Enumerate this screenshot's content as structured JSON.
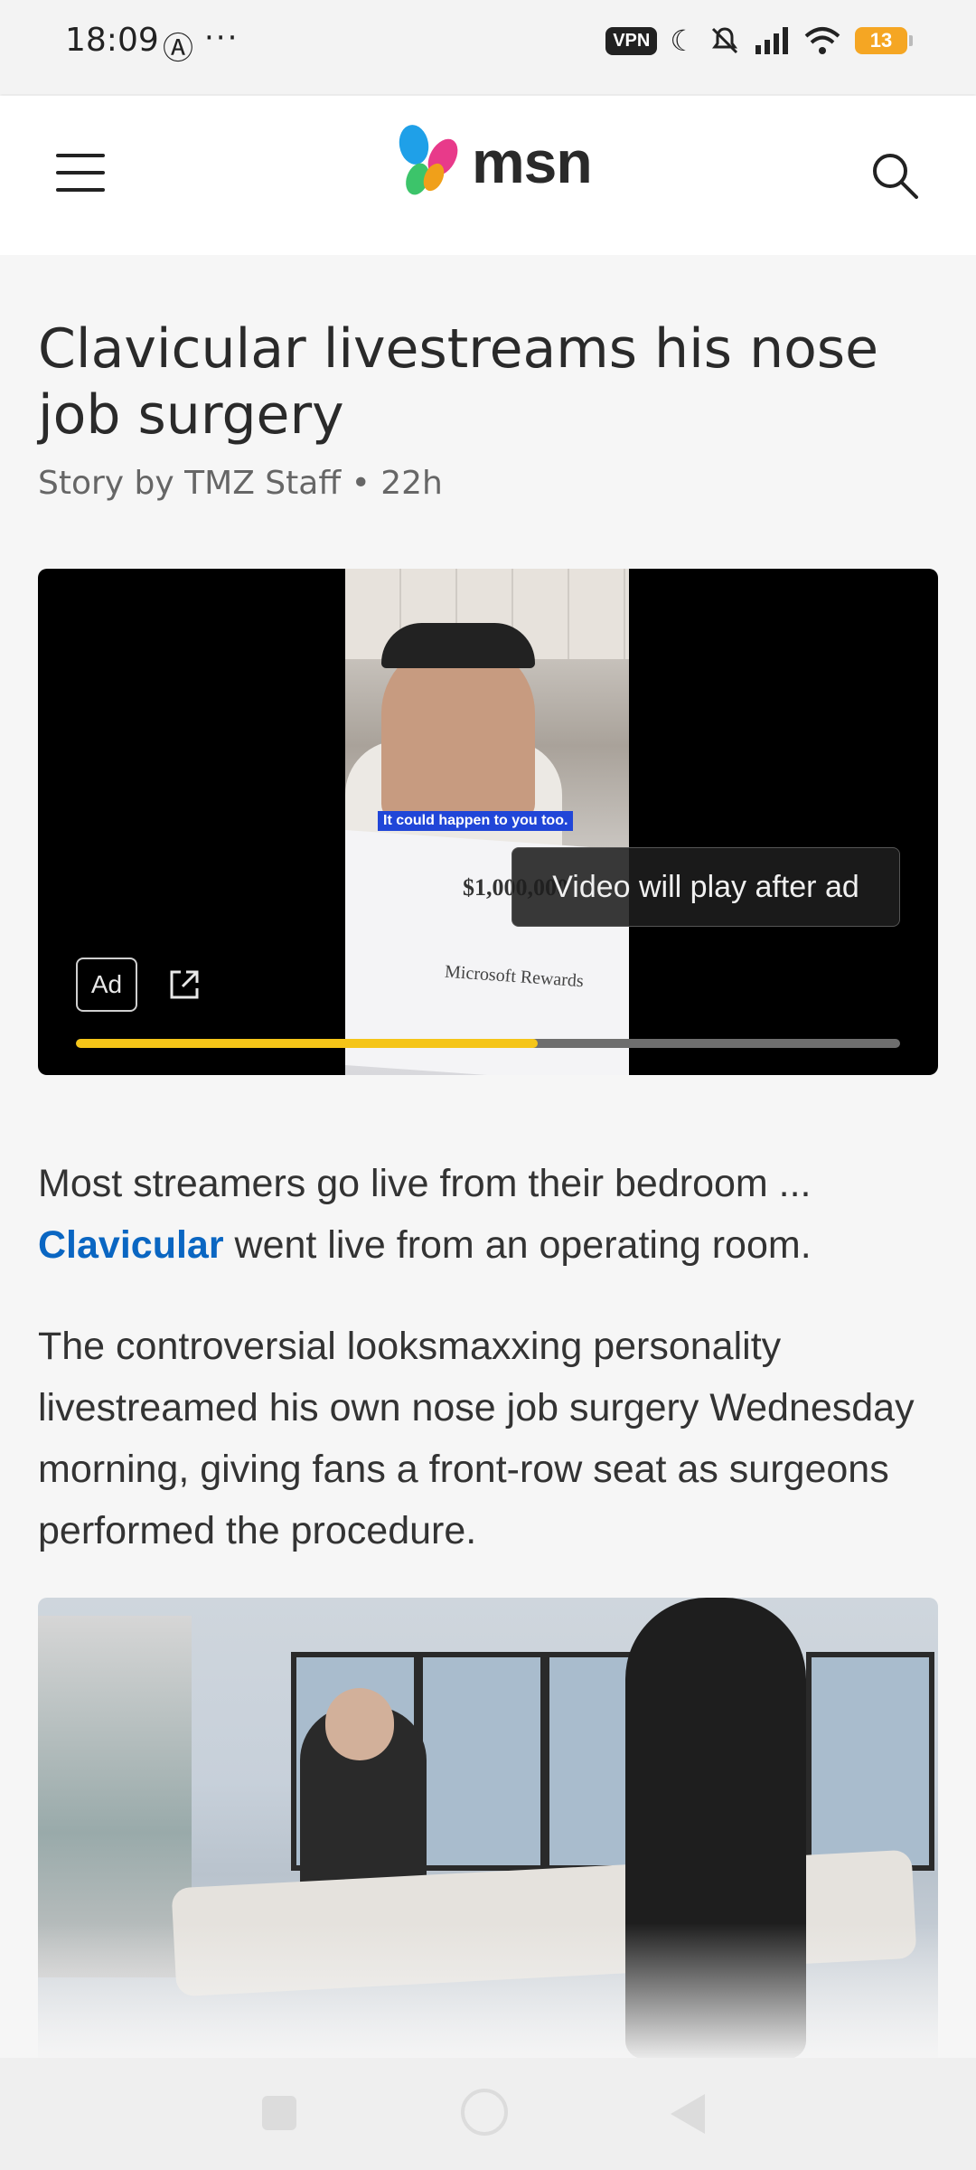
{
  "status_bar": {
    "time": "18:09",
    "dots": "···",
    "vpn_label": "VPN",
    "battery_level": "13",
    "icons": [
      "anarchy-icon",
      "moon-icon",
      "mute-icon",
      "signal-icon",
      "wifi-icon"
    ]
  },
  "header": {
    "logo_text": "msn",
    "brand_colors": [
      "#1fa0e8",
      "#f0a01a",
      "#e83a8a",
      "#3cc46a"
    ]
  },
  "article": {
    "title": "Clavicular livestreams his nose job surgery",
    "byline": "Story by TMZ Staff • 22h",
    "paragraph1_before": "Most streamers go live from their bedroom ...",
    "paragraph1_link": "Clavicular",
    "paragraph1_after": " went live from an operating room.",
    "paragraph2": "The controversial looksmaxxing personality livestreamed his own nose job surgery Wednesday morning, giving fans a front-row seat as surgeons performed the procedure.",
    "link_color": "#0a66c2"
  },
  "video": {
    "caption": "It could happen to you too.",
    "check_amount": "$1,000,000",
    "check_signature": "Microsoft Rewards",
    "message": "Video will play after ad",
    "ad_label": "Ad",
    "progress": 0.56,
    "progress_color": "#f5c518"
  }
}
